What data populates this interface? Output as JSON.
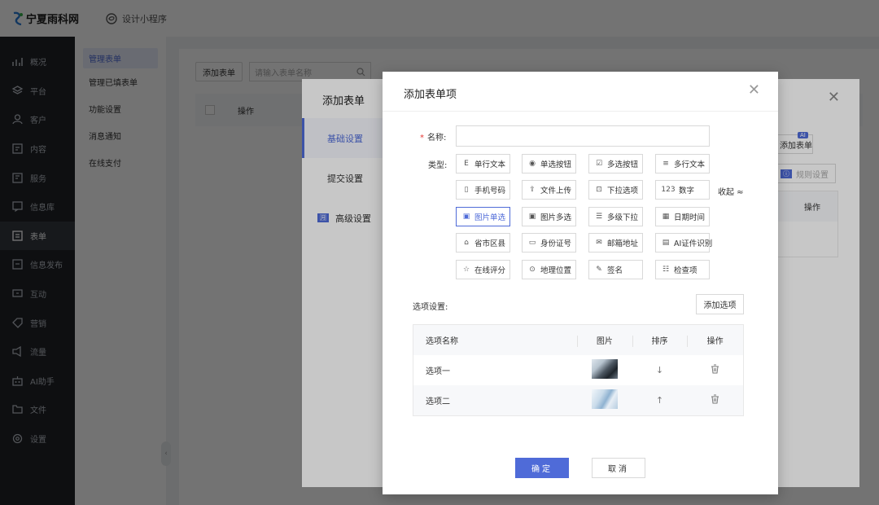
{
  "brand": {
    "name": "宁夏雨科网"
  },
  "topbar": {
    "mini_program": "设计小程序"
  },
  "nav": {
    "items": [
      {
        "label": "概况",
        "icon": "chart-icon"
      },
      {
        "label": "平台",
        "icon": "layers-icon"
      },
      {
        "label": "客户",
        "icon": "user-icon"
      },
      {
        "label": "内容",
        "icon": "content-icon"
      },
      {
        "label": "服务",
        "icon": "service-icon"
      },
      {
        "label": "信息库",
        "icon": "message-icon"
      },
      {
        "label": "表单",
        "icon": "form-icon",
        "active": true
      },
      {
        "label": "信息发布",
        "icon": "publish-icon"
      },
      {
        "label": "互动",
        "icon": "interact-icon"
      },
      {
        "label": "营销",
        "icon": "tag-icon"
      },
      {
        "label": "流量",
        "icon": "traffic-icon"
      },
      {
        "label": "AI助手",
        "icon": "robot-icon"
      },
      {
        "label": "文件",
        "icon": "folder-icon"
      },
      {
        "label": "设置",
        "icon": "gear-icon"
      }
    ]
  },
  "subnav": {
    "items": [
      "管理表单",
      "管理已填表单",
      "功能设置",
      "消息通知",
      "在线支付"
    ]
  },
  "page": {
    "add_form": "添加表单",
    "search_placeholder": "请输入表单名称",
    "col_operation": "操作"
  },
  "back_dialog": {
    "title": "添加表单",
    "tabs": [
      "基础设置",
      "提交设置",
      "高级设置"
    ],
    "tab_badge": "🈷",
    "add_form_btn": "添加表单",
    "ai_tag": "AI",
    "rule_btn": "规则设置",
    "rule_badge": "ⓘ",
    "ops": "操作"
  },
  "dialog": {
    "title": "添加表单项",
    "name_label": "名称:",
    "type_label": "类型:",
    "collapse": "收起 ≈",
    "types": [
      {
        "label": "单行文本",
        "icon": "E"
      },
      {
        "label": "单选按钮",
        "icon": "◉"
      },
      {
        "label": "多选按钮",
        "icon": "☑"
      },
      {
        "label": "多行文本",
        "icon": "≡"
      },
      {
        "label": "手机号码",
        "icon": "▯"
      },
      {
        "label": "文件上传",
        "icon": "⇪"
      },
      {
        "label": "下拉选项",
        "icon": "⊡"
      },
      {
        "label": "数字",
        "icon": "123"
      },
      {
        "label": "图片单选",
        "icon": "▣",
        "selected": true
      },
      {
        "label": "图片多选",
        "icon": "▣"
      },
      {
        "label": "多级下拉",
        "icon": "☰"
      },
      {
        "label": "日期时间",
        "icon": "▦"
      },
      {
        "label": "省市区县",
        "icon": "⌂"
      },
      {
        "label": "身份证号",
        "icon": "▭"
      },
      {
        "label": "邮箱地址",
        "icon": "✉"
      },
      {
        "label": "AI证件识别",
        "icon": "▤"
      },
      {
        "label": "在线评分",
        "icon": "☆"
      },
      {
        "label": "地理位置",
        "icon": "⊙"
      },
      {
        "label": "签名",
        "icon": "✎"
      },
      {
        "label": "检查项",
        "icon": "☷"
      }
    ],
    "options_label": "选项设置:",
    "add_option": "添加选项",
    "table": {
      "headers": [
        "选项名称",
        "图片",
        "排序",
        "操作"
      ],
      "rows": [
        {
          "name": "选项一",
          "sort": "↓"
        },
        {
          "name": "选项二",
          "sort": "↑"
        }
      ]
    },
    "ok": "确定",
    "cancel": "取消"
  }
}
